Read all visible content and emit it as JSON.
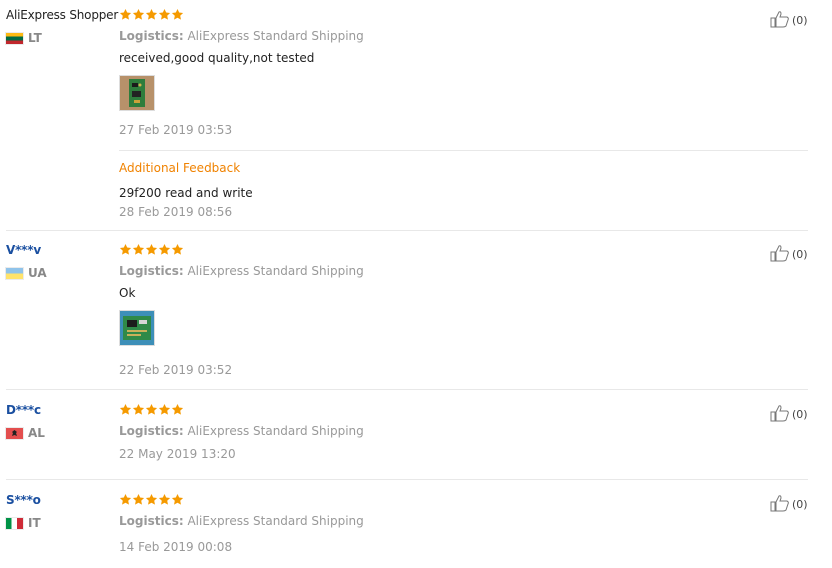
{
  "reviews": [
    {
      "user": "AliExpress Shopper",
      "country": "LT",
      "flag_colors": [
        "#fdb913",
        "#006a44",
        "#c1272d"
      ],
      "logistics_label": "Logistics:",
      "logistics_value": "AliExpress Standard Shipping",
      "text": "received,good quality,not tested",
      "date": "27 Feb 2019 03:53",
      "additional_title": "Additional Feedback",
      "additional_text": "29f200 read and write",
      "additional_date": "28 Feb 2019 08:56",
      "like_count": "(0)"
    },
    {
      "user": "V***v",
      "country": "UA",
      "flag_colors": [
        "#0057b7",
        "#ffd700"
      ],
      "logistics_label": "Logistics:",
      "logistics_value": "AliExpress Standard Shipping",
      "text": "Ok",
      "date": "22 Feb 2019 03:52",
      "like_count": "(0)"
    },
    {
      "user": "D***c",
      "country": "AL",
      "flag_colors": [
        "#e41e20"
      ],
      "logistics_label": "Logistics:",
      "logistics_value": "AliExpress Standard Shipping",
      "date": "22 May 2019 13:20",
      "like_count": "(0)"
    },
    {
      "user": "S***o",
      "country": "IT",
      "flag_colors": [
        "#009246",
        "#ffffff",
        "#ce2b37"
      ],
      "logistics_label": "Logistics:",
      "logistics_value": "AliExpress Standard Shipping",
      "date": "14 Feb 2019 00:08",
      "like_count": "(0)"
    }
  ],
  "rating": 5,
  "star_color": "#f59a00",
  "icons": {
    "star": "star-icon",
    "like": "thumbs-up-icon"
  }
}
